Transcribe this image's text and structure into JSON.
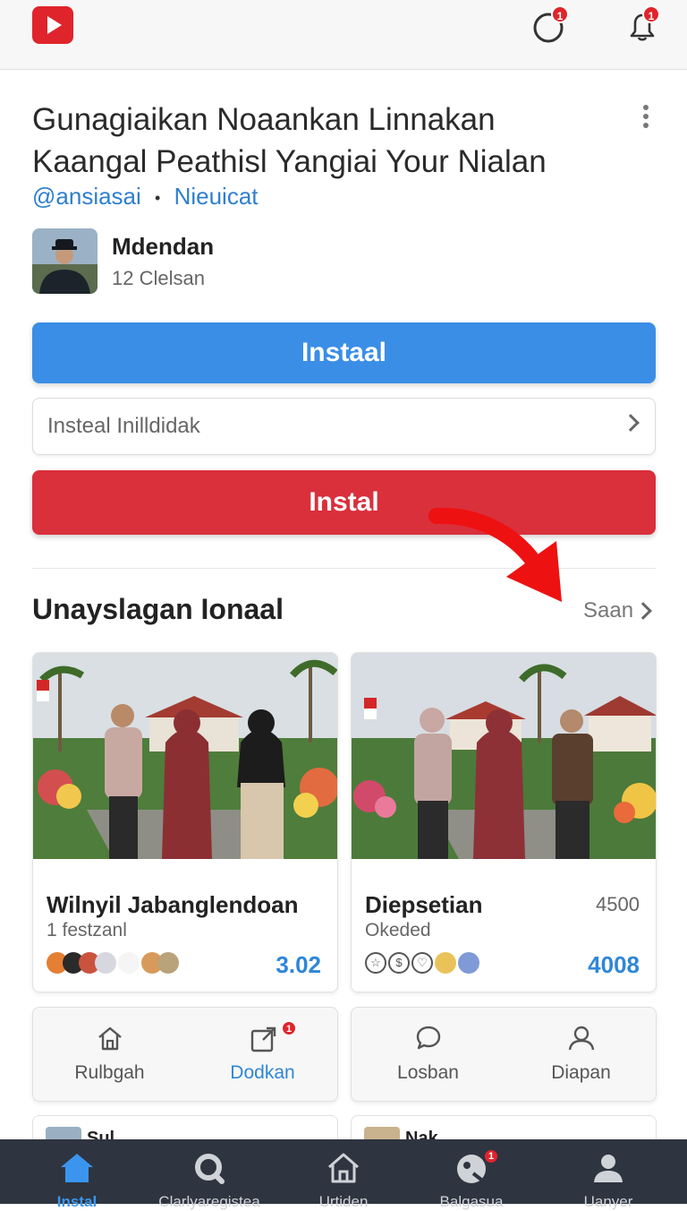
{
  "header": {
    "logo_icon": "play-logo-icon",
    "icons": [
      {
        "name": "activity-icon",
        "badge": "1"
      },
      {
        "name": "bell-icon",
        "badge": "1"
      }
    ]
  },
  "video": {
    "title": "Gunagiaikan Noaankan Linnakan Kaangal Peathisl Yangiai Your Nialan",
    "handle": "@ansiasai",
    "separator": "•",
    "category": "Nieuicat"
  },
  "channel": {
    "name": "Mdendan",
    "subtitle": "12 Clelsan"
  },
  "buttons": {
    "primary_blue": "Instaal",
    "secondary_row": "Insteal Inilldidak",
    "primary_red": "Instal"
  },
  "section": {
    "title": "Unayslagan Ionaal",
    "see_all": "Saan"
  },
  "cards": [
    {
      "title": "Wilnyil Jabanglendoan",
      "subtitle": "1 festzanl",
      "count": "",
      "value": "3.02"
    },
    {
      "title": "Diepsetian",
      "subtitle": "Okeded",
      "count": "4500",
      "value": "4008"
    }
  ],
  "actions": [
    {
      "label": "Rulbgah",
      "icon": "home-outline-icon",
      "badge": ""
    },
    {
      "label": "Dodkan",
      "icon": "share-box-icon",
      "badge": "1",
      "highlight": true
    },
    {
      "label": "Losban",
      "icon": "chat-bubble-icon",
      "badge": ""
    },
    {
      "label": "Diapan",
      "icon": "person-icon",
      "badge": ""
    }
  ],
  "peek": [
    {
      "label": "Sul"
    },
    {
      "label": "Nak"
    }
  ],
  "bottom_nav": [
    {
      "label": "Instal",
      "icon": "home-icon",
      "active": true
    },
    {
      "label": "Clarlyaregistea",
      "icon": "search-icon",
      "active": false
    },
    {
      "label": "Urtiden",
      "icon": "home-outline-icon",
      "active": false
    },
    {
      "label": "Balgasua",
      "icon": "globe-icon",
      "badge": "1",
      "active": false
    },
    {
      "label": "Uanyer",
      "icon": "account-icon",
      "active": false
    }
  ],
  "colors": {
    "accent_blue": "#3a8ee6",
    "accent_red": "#d9303c",
    "link_blue": "#2f7fd0",
    "nav_bg": "#2e3540",
    "badge_red": "#e0242b"
  }
}
